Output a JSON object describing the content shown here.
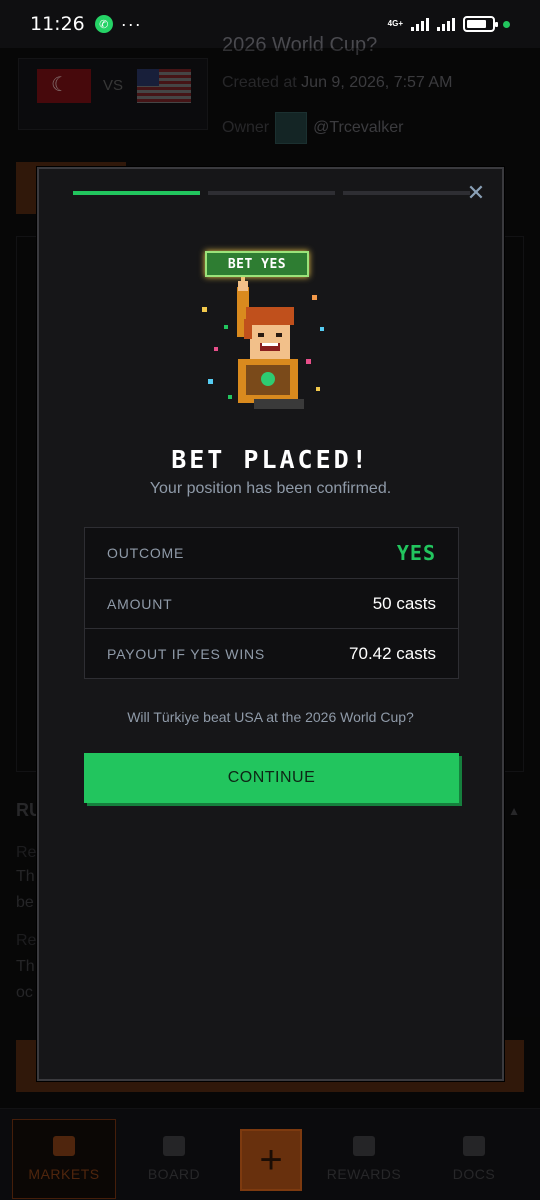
{
  "status_bar": {
    "time": "11:26",
    "dots": "···",
    "network": "4G+"
  },
  "background_page": {
    "title_fragment": "2026 World Cup?",
    "vs_label": "VS",
    "created_label": "Created at",
    "created_value": "Jun 9, 2026, 7:57 AM",
    "owner_label": "Owner",
    "owner_handle": "@Trcevalker",
    "rules_title": "RU",
    "rule_lines": [
      "Re",
      "Th",
      "be",
      "Re",
      "Th",
      "oc"
    ]
  },
  "modal": {
    "close_glyph": "✕",
    "progress_steps": [
      true,
      false,
      false
    ],
    "badge_text": "BET YES",
    "title": "BET PLACED!",
    "subtitle": "Your position has been confirmed.",
    "summary": {
      "outcome_label": "OUTCOME",
      "outcome_value": "YES",
      "amount_label": "AMOUNT",
      "amount_value": "50 casts",
      "payout_label": "PAYOUT IF YES WINS",
      "payout_value": "70.42 casts"
    },
    "question": "Will Türkiye beat USA at the 2026 World Cup?",
    "continue_label": "CONTINUE"
  },
  "bottom_nav": {
    "items": [
      {
        "label": "MARKETS",
        "icon": "store-icon",
        "active": true
      },
      {
        "label": "BOARD",
        "icon": "trophy-icon",
        "active": false
      },
      {
        "label": "REWARDS",
        "icon": "gift-icon",
        "active": false
      },
      {
        "label": "DOCS",
        "icon": "folder-icon",
        "active": false
      }
    ],
    "plus_glyph": "+"
  },
  "colors": {
    "accent_green": "#22c55e",
    "accent_orange": "#c05a18",
    "modal_bg": "#161618"
  }
}
